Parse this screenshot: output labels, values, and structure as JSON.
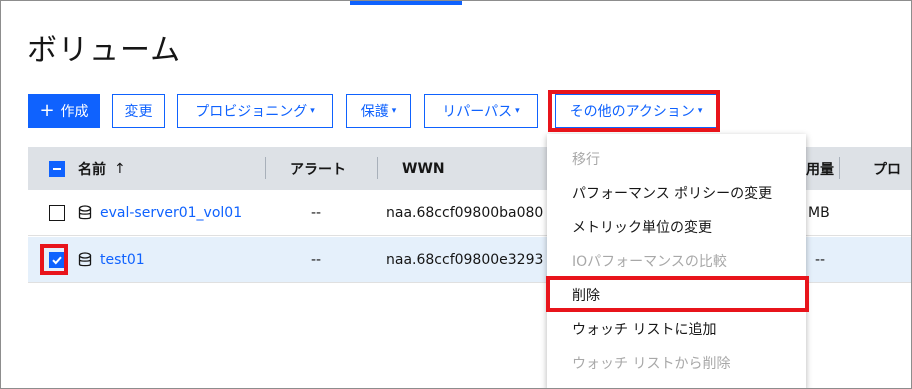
{
  "page": {
    "title": "ボリューム"
  },
  "toolbar": {
    "create_label": "作成",
    "create_icon": "plus-icon",
    "change_label": "変更",
    "provisioning_label": "プロビジョニング",
    "protect_label": "保護",
    "repurpose_label": "リパーパス",
    "other_actions_label": "その他のアクション",
    "caret_glyph": "▾"
  },
  "table": {
    "columns": {
      "name": "名前",
      "sort_glyph": "↑",
      "alert": "アラート",
      "wwn": "WWN",
      "capacity_partial": "用量",
      "provisioning_partial": "プロ"
    },
    "rows": [
      {
        "name": "eval-server01_vol01",
        "alert": "--",
        "wwn": "naa.68ccf09800ba080",
        "capacity": "MB",
        "checked": false
      },
      {
        "name": "test01",
        "alert": "--",
        "wwn": "naa.68ccf09800e3293",
        "capacity": "--",
        "checked": true
      }
    ]
  },
  "menu": {
    "items": [
      {
        "label": "移行",
        "disabled": true
      },
      {
        "label": "パフォーマンス ポリシーの変更",
        "disabled": false
      },
      {
        "label": "メトリック単位の変更",
        "disabled": false
      },
      {
        "label": "IOパフォーマンスの比較",
        "disabled": true
      },
      {
        "label": "削除",
        "disabled": false
      },
      {
        "label": "ウォッチ リストに追加",
        "disabled": false
      },
      {
        "label": "ウォッチ リストから削除",
        "disabled": true
      }
    ]
  },
  "colors": {
    "accent": "#0f62fe",
    "highlight": "#e8141b",
    "header_bg": "#dde1e6",
    "selected_row_bg": "#e5f0fb",
    "disabled_text": "#a8a8a8"
  }
}
